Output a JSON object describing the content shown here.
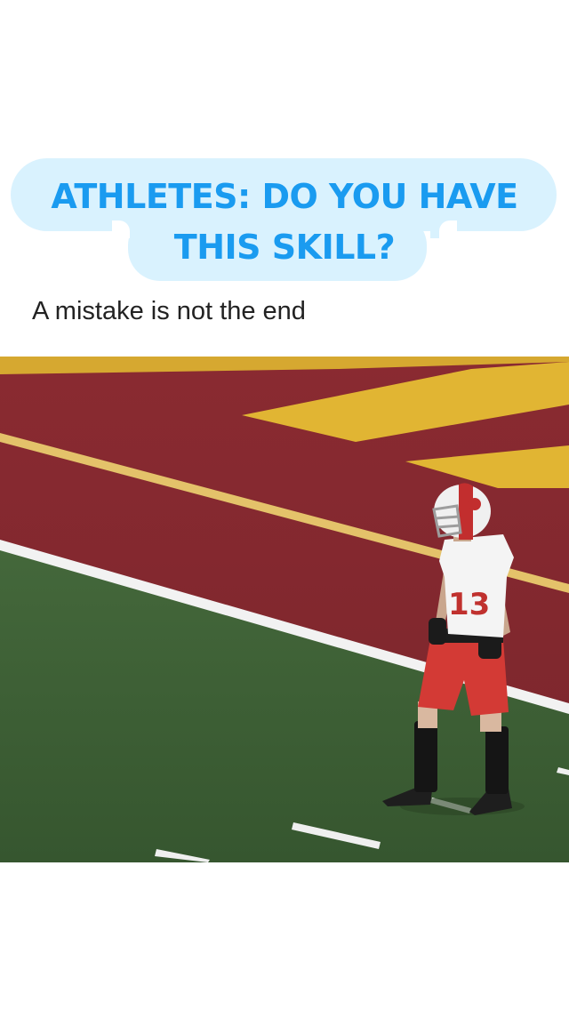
{
  "headline": {
    "line1": "ATHLETES: DO YOU HAVE",
    "line2": "THIS SKILL?",
    "text_color": "#1a9bf0",
    "bubble_color": "#d9f2fe"
  },
  "subtitle": "A mistake is not the end",
  "video": {
    "jersey_number": "13",
    "field_colors": {
      "endzone": "#82282e",
      "stripe": "#e1b533",
      "grass": "#3d5f36",
      "line": "#f2f2f2"
    }
  }
}
